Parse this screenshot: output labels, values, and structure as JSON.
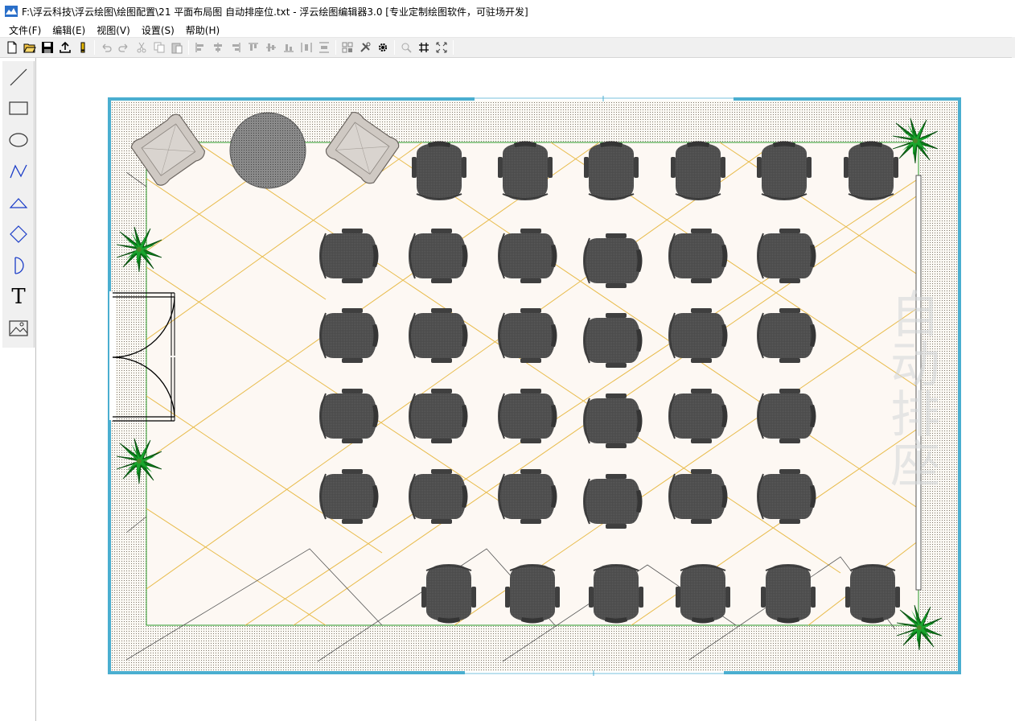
{
  "window": {
    "title": "F:\\浮云科技\\浮云绘图\\绘图配置\\21 平面布局图 自动排座位.txt - 浮云绘图编辑器3.0 [专业定制绘图软件，可驻场开发]"
  },
  "menu": [
    {
      "label": "文件(F)"
    },
    {
      "label": "编辑(E)"
    },
    {
      "label": "视图(V)"
    },
    {
      "label": "设置(S)"
    },
    {
      "label": "帮助(H)"
    }
  ],
  "toolbar": {
    "buttons": [
      "new-file-icon",
      "open-folder-icon",
      "save-icon",
      "export-icon",
      "alert-icon",
      "undo-icon",
      "redo-icon",
      "cut-icon",
      "copy-icon",
      "paste-icon",
      "align-left-icon",
      "align-center-icon",
      "align-right-icon",
      "align-top-icon",
      "align-middle-icon",
      "align-bottom-icon",
      "distribute-horizontal-icon",
      "distribute-vertical-icon",
      "group-icon",
      "tools-icon",
      "settings-gear-icon",
      "zoom-icon",
      "grid-icon",
      "fit-screen-icon"
    ]
  },
  "toolbox": {
    "tools": [
      "line-tool-icon",
      "rectangle-tool-icon",
      "ellipse-tool-icon",
      "polyline-tool-icon",
      "triangle-tool-icon",
      "diamond-tool-icon",
      "arc-tool-icon",
      "text-tool-icon",
      "image-tool-icon"
    ],
    "text_tool_glyph": "T"
  },
  "drawing": {
    "watermark": "自动排座",
    "colors": {
      "wall": "#4aaed0",
      "floor": "#fdf8f3",
      "carpet_border": "#2a9a2a",
      "grid_lines": "#e8bb4a",
      "chair": "#4b4b4b",
      "sofa": "#cfc9c3",
      "plant": "#0c8a1e"
    }
  }
}
